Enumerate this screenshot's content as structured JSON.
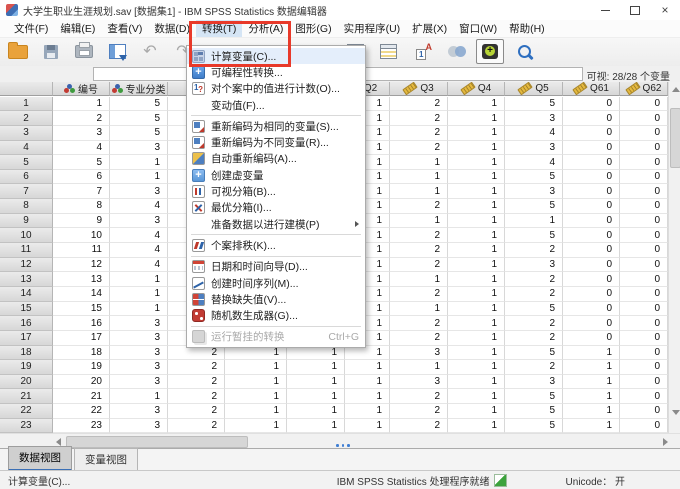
{
  "window": {
    "title": "大学生职业生涯规划.sav [数据集1] - IBM SPSS Statistics 数据编辑器"
  },
  "menu_bar": {
    "items": [
      {
        "label": "文件(F)"
      },
      {
        "label": "编辑(E)"
      },
      {
        "label": "查看(V)"
      },
      {
        "label": "数据(D)"
      },
      {
        "label": "转换(T)",
        "active": true
      },
      {
        "label": "分析(A)"
      },
      {
        "label": "图形(G)"
      },
      {
        "label": "实用程序(U)"
      },
      {
        "label": "扩展(X)"
      },
      {
        "label": "窗口(W)"
      },
      {
        "label": "帮助(H)"
      }
    ]
  },
  "toolbar": {
    "left_icons": [
      "open-data-document",
      "save-document",
      "print",
      "recall-recent-dialogs",
      "undo",
      "redo"
    ],
    "right_icons": [
      "insert-cases",
      "insert-variable",
      "value-labels",
      "use-variable-sets",
      "show-all-variables",
      "find"
    ]
  },
  "cell_reference_bar": {
    "editor_value": "",
    "visible_variables": "可视: 28/28 个变量"
  },
  "transform_menu": {
    "items": [
      {
        "icon": "calculator",
        "label": "计算变量(C)...",
        "highlight": true
      },
      {
        "icon": "plus",
        "label": "可编程性转换..."
      },
      {
        "icon": "count",
        "label": "对个案中的值进行计数(O)..."
      },
      {
        "icon": "none",
        "label": "变动值(F)...",
        "separator_after": true
      },
      {
        "icon": "recode",
        "label": "重新编码为相同的变量(S)..."
      },
      {
        "icon": "recode",
        "label": "重新编码为不同变量(R)..."
      },
      {
        "icon": "auto-recode",
        "label": "自动重新编码(A)..."
      },
      {
        "icon": "plus-light",
        "label": "创建虚变量"
      },
      {
        "icon": "binning",
        "label": "可视分箱(B)..."
      },
      {
        "icon": "optimal",
        "label": "最优分箱(I)..."
      },
      {
        "icon": "none",
        "label": "准备数据以进行建模(P)",
        "submenu": true,
        "separator_after": true
      },
      {
        "icon": "rank",
        "label": "个案排秩(K)...",
        "separator_after": true
      },
      {
        "icon": "datetime",
        "label": "日期和时间向导(D)..."
      },
      {
        "icon": "timeseries",
        "label": "创建时间序列(M)..."
      },
      {
        "icon": "missing",
        "label": "替换缺失值(V)..."
      },
      {
        "icon": "random",
        "label": "随机数生成器(G)...",
        "separator_after": true
      },
      {
        "icon": "run-pending",
        "label": "运行暂挂的转换",
        "shortcut": "Ctrl+G",
        "disabled": true
      }
    ]
  },
  "annotation": {
    "color": "#e8392a"
  },
  "grid": {
    "columns": [
      {
        "label": "编号",
        "measure": "nominal"
      },
      {
        "label": "专业分类",
        "measure": "nominal"
      },
      {
        "label": "",
        "measure": "none"
      },
      {
        "label": "",
        "measure": "none"
      },
      {
        "label": "",
        "measure": "none"
      },
      {
        "label": "Q2",
        "measure": "scale",
        "clipped": true
      },
      {
        "label": "Q3",
        "measure": "scale"
      },
      {
        "label": "Q4",
        "measure": "scale"
      },
      {
        "label": "Q5",
        "measure": "scale"
      },
      {
        "label": "Q61",
        "measure": "scale"
      },
      {
        "label": "Q62",
        "measure": "scale"
      }
    ],
    "rows": [
      [
        1,
        1,
        5,
        2,
        1,
        1,
        1,
        2,
        1,
        5,
        0,
        0
      ],
      [
        2,
        2,
        5,
        2,
        1,
        1,
        1,
        2,
        1,
        3,
        0,
        0
      ],
      [
        3,
        3,
        5,
        2,
        1,
        1,
        1,
        2,
        1,
        4,
        0,
        0
      ],
      [
        4,
        4,
        3,
        2,
        1,
        1,
        1,
        2,
        1,
        3,
        0,
        0
      ],
      [
        5,
        5,
        1,
        2,
        1,
        1,
        1,
        1,
        1,
        4,
        0,
        0
      ],
      [
        6,
        6,
        1,
        2,
        1,
        1,
        1,
        1,
        1,
        5,
        0,
        0
      ],
      [
        7,
        7,
        3,
        2,
        1,
        1,
        1,
        1,
        1,
        3,
        0,
        0
      ],
      [
        8,
        8,
        4,
        2,
        1,
        1,
        1,
        2,
        1,
        5,
        0,
        0
      ],
      [
        9,
        9,
        3,
        2,
        1,
        1,
        1,
        1,
        1,
        1,
        0,
        0
      ],
      [
        10,
        10,
        4,
        2,
        1,
        1,
        1,
        2,
        1,
        5,
        0,
        0
      ],
      [
        11,
        11,
        4,
        2,
        1,
        1,
        1,
        2,
        1,
        2,
        0,
        0
      ],
      [
        12,
        12,
        4,
        2,
        1,
        1,
        1,
        2,
        1,
        3,
        0,
        0
      ],
      [
        13,
        13,
        1,
        2,
        1,
        1,
        1,
        1,
        1,
        2,
        0,
        0
      ],
      [
        14,
        14,
        1,
        2,
        1,
        1,
        1,
        2,
        1,
        2,
        0,
        0
      ],
      [
        15,
        15,
        1,
        2,
        1,
        1,
        1,
        1,
        1,
        5,
        0,
        0
      ],
      [
        16,
        16,
        3,
        2,
        1,
        1,
        1,
        2,
        1,
        2,
        0,
        0
      ],
      [
        17,
        17,
        3,
        2,
        1,
        1,
        1,
        2,
        1,
        2,
        0,
        0
      ],
      [
        18,
        18,
        3,
        2,
        1,
        1,
        1,
        3,
        1,
        5,
        1,
        0
      ],
      [
        19,
        19,
        3,
        2,
        1,
        1,
        1,
        1,
        1,
        2,
        1,
        0
      ],
      [
        20,
        20,
        3,
        2,
        1,
        1,
        1,
        3,
        1,
        3,
        1,
        0
      ],
      [
        21,
        21,
        1,
        2,
        1,
        1,
        1,
        2,
        1,
        5,
        1,
        0
      ],
      [
        22,
        22,
        3,
        2,
        1,
        1,
        1,
        2,
        1,
        5,
        1,
        0
      ],
      [
        23,
        23,
        3,
        2,
        1,
        1,
        1,
        2,
        1,
        5,
        1,
        0
      ]
    ]
  },
  "view_tabs": {
    "data_view": "数据视图",
    "variable_view": "变量视图",
    "active": "数据视图"
  },
  "status_bar": {
    "hint": "计算变量(C)...",
    "message": "IBM SPSS Statistics 处理程序就绪",
    "unicode": "Unicode： 开"
  }
}
